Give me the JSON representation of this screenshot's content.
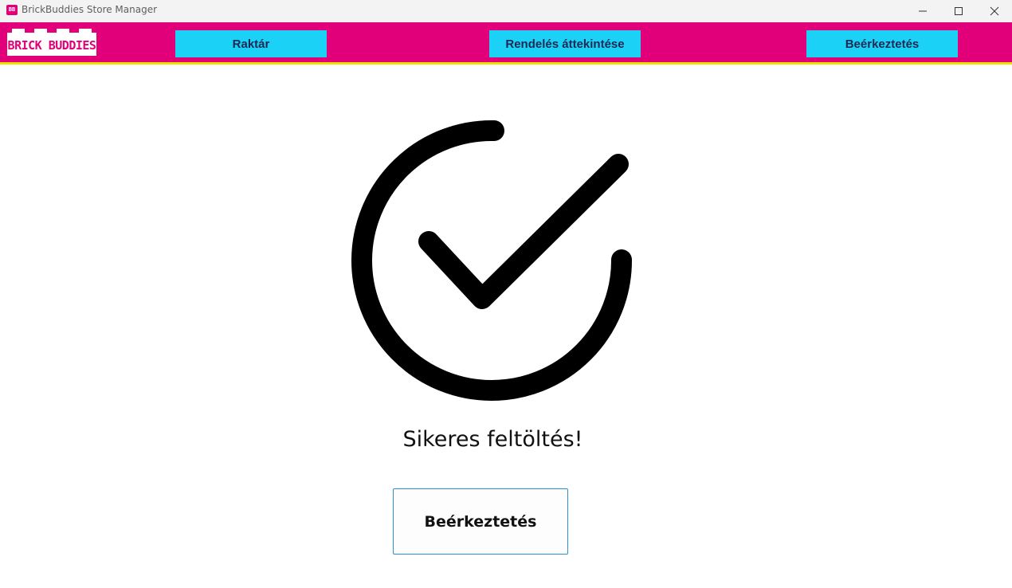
{
  "window": {
    "title": "BrickBuddies Store Manager",
    "icon": "app-icon",
    "controls": [
      "minimize-icon",
      "maximize-icon",
      "close-icon"
    ]
  },
  "logo": {
    "text": "BRICK BUDDIES"
  },
  "nav": {
    "items": [
      {
        "label": "Raktár"
      },
      {
        "label": "Rendelés áttekintése"
      },
      {
        "label": "Beérkeztetés"
      }
    ]
  },
  "main": {
    "icon": "success-checkmark-icon",
    "message": "Sikeres feltöltés!",
    "button_label": "Beérkeztetés"
  },
  "colors": {
    "navbar": "#e2007a",
    "nav_button": "#1cd1f6",
    "nav_button_text": "#1b2a55",
    "accent_line": "#f4e000",
    "button_border": "#2b8fd6"
  }
}
